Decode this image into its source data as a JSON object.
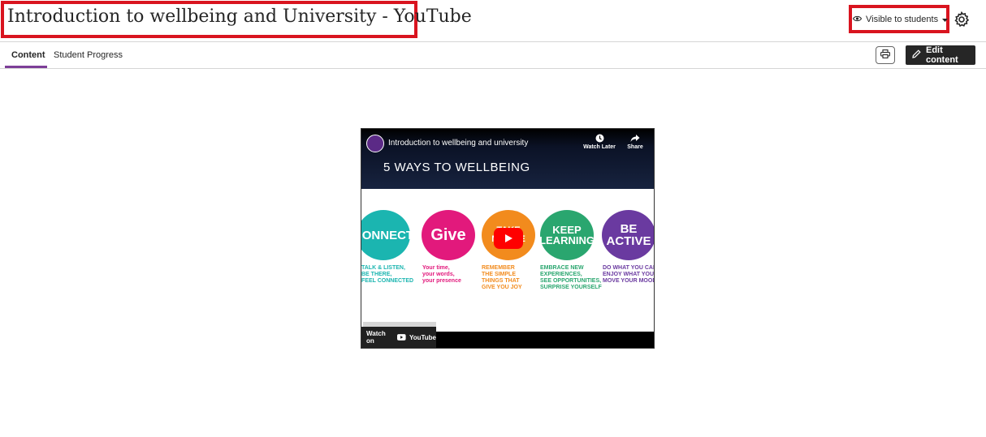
{
  "page": {
    "title": "Introduction to wellbeing and University - YouTube"
  },
  "visibility": {
    "label": "Visible to students",
    "icon": "eye-icon"
  },
  "settings": {
    "icon": "gear-icon"
  },
  "tabs": [
    {
      "label": "Content",
      "active": true
    },
    {
      "label": "Student Progress",
      "active": false
    }
  ],
  "toolbar": {
    "print_icon": "print-icon",
    "edit_label": "Edit content"
  },
  "video": {
    "title": "Introduction to wellbeing and university",
    "watch_later": "Watch Later",
    "share": "Share",
    "slide_title": "5 WAYS TO WELLBEING",
    "watch_on": "Watch on",
    "youtube": "YouTube",
    "ways": [
      {
        "word": "CONNECT",
        "caption": "TALK & LISTEN,\nBE THERE,\nFEEL CONNECTED",
        "color": "#1bb5b0"
      },
      {
        "word": "Give",
        "caption": "Your time,\nyour words,\nyour presence",
        "color": "#e2197c"
      },
      {
        "word": "TAKE NOTICE",
        "caption": "REMEMBER\nTHE SIMPLE\nTHINGS THAT\nGIVE YOU JOY",
        "color": "#f28b1d"
      },
      {
        "word": "KEEP LEARNING",
        "caption": "EMBRACE NEW\nEXPERIENCES,\nSEE OPPORTUNITIES,\nSURPRISE YOURSELF",
        "color": "#2aa66f"
      },
      {
        "word": "BE ACTIVE",
        "caption": "DO WHAT YOU CAN,\nENJOY WHAT YOU DO,\nMOVE YOUR MOOD",
        "color": "#6a3aa0"
      }
    ]
  },
  "colors": {
    "accent": "#7d3f98",
    "highlight": "#d9141f"
  }
}
